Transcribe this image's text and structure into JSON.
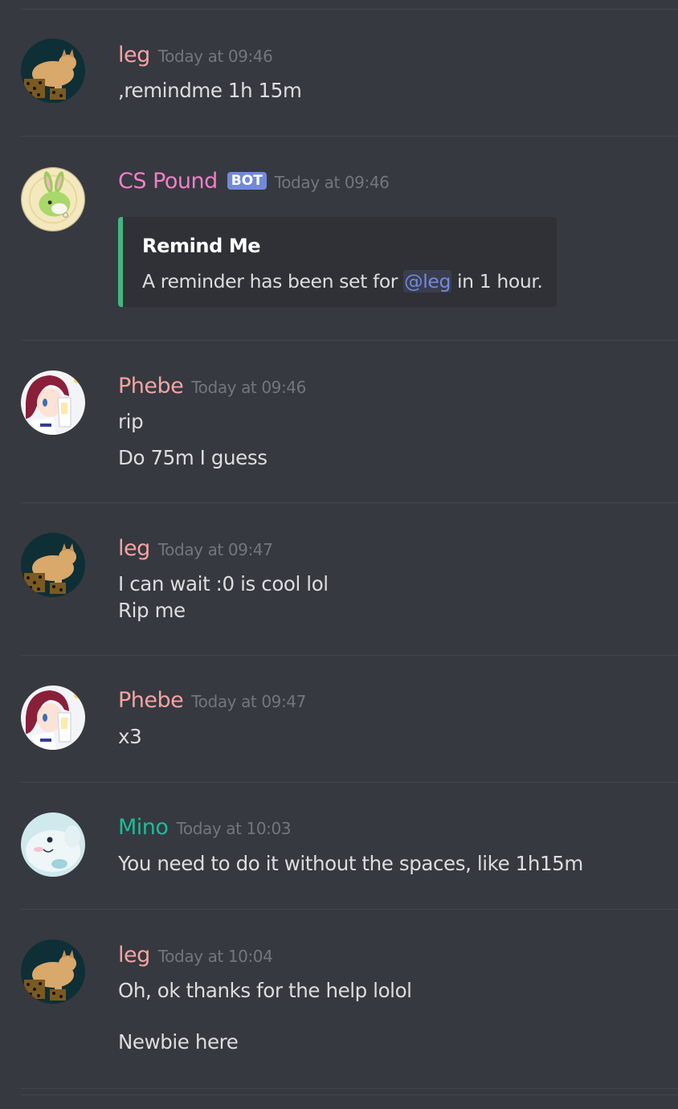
{
  "colors": {
    "background": "#36393f",
    "divider": "#42454a",
    "text": "#dcddde",
    "timestamp": "#72767d",
    "embed_bg": "#2f3136",
    "embed_accent": "#43b581",
    "bot_tag": "#7289da",
    "mention": "#7289da"
  },
  "messages": [
    {
      "author": "leg",
      "author_color": "#f47fff",
      "timestamp": "Today at 09:46",
      "avatar": "cat-avatar",
      "lines": [
        ",remindme 1h 15m"
      ]
    },
    {
      "author": "CS Pound",
      "bot_tag": "BOT",
      "timestamp": "Today at 09:46",
      "avatar": "bunny-avatar",
      "embed": {
        "title": "Remind Me",
        "desc_before": "A reminder has been set for ",
        "mention": "@leg",
        "desc_after": " in 1 hour."
      }
    },
    {
      "author": "Phebe",
      "timestamp": "Today at 09:46",
      "avatar": "anime-girl-avatar",
      "lines": [
        "rip",
        "Do 75m I guess"
      ]
    },
    {
      "author": "leg",
      "timestamp": "Today at 09:47",
      "avatar": "cat-avatar",
      "lines": [
        "I can wait :0 is cool lol",
        "Rip me"
      ]
    },
    {
      "author": "Phebe",
      "timestamp": "Today at 09:47",
      "avatar": "anime-girl-avatar",
      "lines": [
        "x3"
      ]
    },
    {
      "author": "Mino",
      "timestamp": "Today at 10:03",
      "avatar": "creature-avatar",
      "lines": [
        "You need to do it without the spaces, like 1h15m"
      ]
    },
    {
      "author": "leg",
      "timestamp": "Today at 10:04",
      "avatar": "cat-avatar",
      "lines": [
        "Oh, ok thanks for the help lolol",
        "Newbie here"
      ]
    }
  ],
  "author_colors": {
    "leg": "#f5a3a3",
    "CS Pound": "#f07fc9",
    "Phebe": "#f5a3a3",
    "Mino": "#1abc9c"
  }
}
